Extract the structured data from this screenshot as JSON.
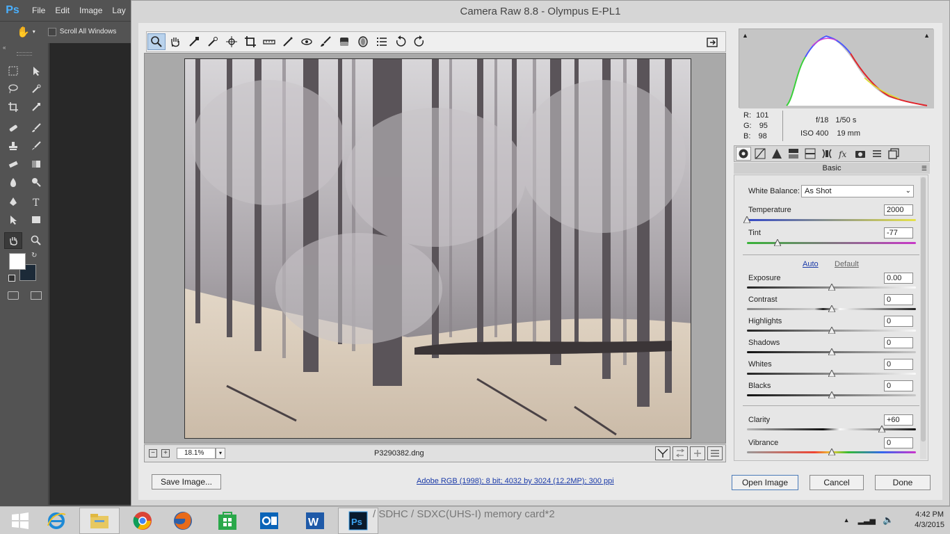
{
  "photoshop": {
    "logo": "Ps",
    "menu": [
      "File",
      "Edit",
      "Image",
      "Lay"
    ],
    "options_bar": {
      "scroll_all_label": "Scroll All Windows"
    }
  },
  "dialog": {
    "title": "Camera Raw 8.8  -  Olympus E-PL1",
    "toolbar_tools": [
      "zoom",
      "hand",
      "white-balance",
      "color-sampler",
      "targeted-adjustment",
      "crop",
      "straighten",
      "spot-removal",
      "red-eye",
      "adjustment-brush",
      "graduated-filter",
      "radial-filter",
      "preferences",
      "rotate-ccw",
      "rotate-cw"
    ],
    "zoom_level": "18.1%",
    "filename": "P3290382.dng",
    "histogram": {
      "rgb": {
        "r_label": "R:",
        "r": "101",
        "g_label": "G:",
        "g": "95",
        "b_label": "B:",
        "b": "98"
      },
      "aperture": "f/18",
      "shutter": "1/50 s",
      "iso": "ISO 400",
      "focal": "19 mm"
    },
    "panel": {
      "title": "Basic",
      "white_balance_label": "White Balance:",
      "white_balance_value": "As Shot",
      "temperature": {
        "label": "Temperature",
        "value": "2000",
        "pos": 0.0
      },
      "tint": {
        "label": "Tint",
        "value": "-77",
        "pos": 0.18
      },
      "auto_label": "Auto",
      "default_label": "Default",
      "adjustments": [
        {
          "label": "Exposure",
          "value": "0.00",
          "pos": 0.5
        },
        {
          "label": "Contrast",
          "value": "0",
          "pos": 0.5
        },
        {
          "label": "Highlights",
          "value": "0",
          "pos": 0.5
        },
        {
          "label": "Shadows",
          "value": "0",
          "pos": 0.5
        },
        {
          "label": "Whites",
          "value": "0",
          "pos": 0.5
        },
        {
          "label": "Blacks",
          "value": "0",
          "pos": 0.5
        }
      ],
      "presence": [
        {
          "label": "Clarity",
          "value": "+60",
          "pos": 0.8
        },
        {
          "label": "Vibrance",
          "value": "0",
          "pos": 0.5
        }
      ]
    },
    "footer": {
      "save_image": "Save Image...",
      "workflow_info": "Adobe RGB (1998); 8 bit; 4032 by 3024 (12.2MP); 300 ppi",
      "open_image": "Open Image",
      "cancel": "Cancel",
      "done": "Done"
    }
  },
  "taskbar": {
    "background_text": "/ SDHC / SDXC(UHS-I) memory card*2",
    "time": "4:42 PM",
    "date": "4/3/2015",
    "apps": [
      "start",
      "internet-explorer",
      "file-explorer",
      "chrome",
      "firefox",
      "store",
      "outlook",
      "word",
      "photoshop"
    ]
  }
}
